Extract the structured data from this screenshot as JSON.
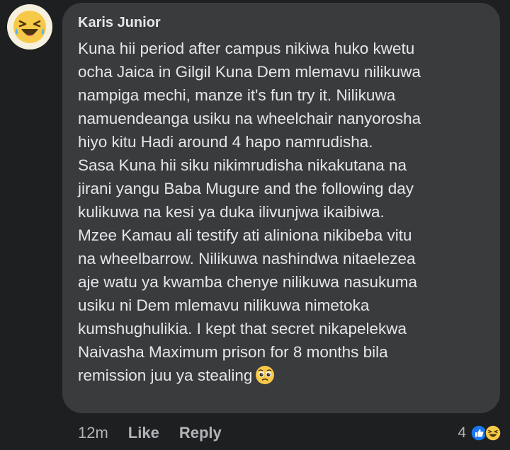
{
  "comment": {
    "author": "Karis Junior",
    "lines": [
      "Kuna hii period after campus nikiwa huko kwetu",
      "ocha Jaica in Gilgil Kuna Dem mlemavu nilikuwa",
      "nampiga mechi, manze it's fun try it. Nilikuwa",
      "namuendeanga usiku na wheelchair nanyorosha",
      "hiyo kitu Hadi around 4 hapo namrudisha.",
      "Sasa Kuna hii siku nikimrudisha nikakutana na",
      "jirani yangu Baba Mugure and the following day",
      "kulikuwa na kesi ya duka ilivunjwa ikaibiwa.",
      "Mzee Kamau ali testify ati aliniona nikibeba vitu",
      "na wheelbarrow. Nilikuwa nashindwa nitaelezea",
      "aje watu ya kwamba chenye nilikuwa nasukuma",
      "usiku ni Dem mlemavu nilikuwa nimetoka",
      "kumshughulikia. I kept that secret nikapelekwa",
      "Naivasha Maximum prison for 8 months bila",
      "remission juu ya stealing"
    ],
    "trailing_emoji": "pleading-face-emoji"
  },
  "actions": {
    "time": "12m",
    "like_label": "Like",
    "reply_label": "Reply"
  },
  "reactions": {
    "count": "4",
    "icons": [
      "like-reaction-icon",
      "haha-reaction-icon"
    ]
  },
  "colors": {
    "background": "#1e1f20",
    "bubble": "#3a3b3c",
    "text": "#e4e6eb",
    "secondary_text": "#b0b3b8",
    "like_blue": "#1877f2",
    "reaction_yellow": "#f7c948"
  }
}
